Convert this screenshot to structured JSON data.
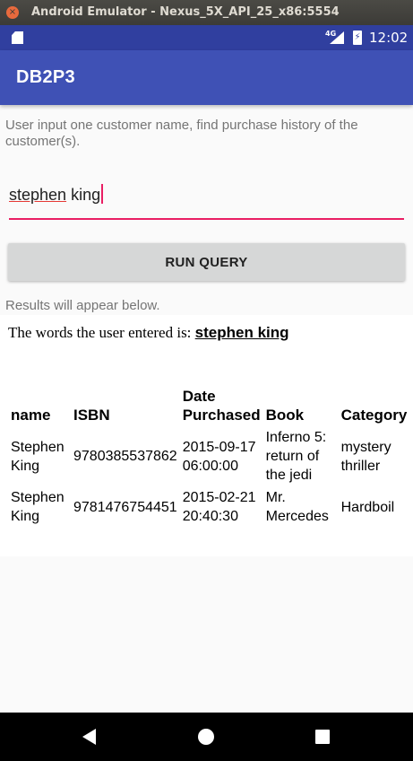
{
  "window": {
    "title": "Android Emulator - Nexus_5X_API_25_x86:5554"
  },
  "status_bar": {
    "network": "4G",
    "time": "12:02"
  },
  "app": {
    "title": "DB2P3"
  },
  "content": {
    "instructions": "User input one customer name, find purchase history of the customer(s).",
    "input_value_part1": "stephen",
    "input_value_part2": " king",
    "run_button": "RUN QUERY",
    "results_hint": "Results will appear below."
  },
  "results": {
    "entered_prefix": "The words the user entered is: ",
    "entered_value": "stephen king",
    "columns": [
      "name",
      "ISBN",
      "Date Purchased",
      "Book",
      "Category"
    ],
    "rows": [
      {
        "name": "Stephen King",
        "isbn": "9780385537862",
        "date": "2015-09-17 06:00:00",
        "book": "Inferno 5: return of the jedi",
        "category": "mystery thriller"
      },
      {
        "name": "Stephen King",
        "isbn": "9781476754451",
        "date": "2015-02-21 20:40:30",
        "book": "Mr. Mercedes",
        "category": "Hardboil"
      }
    ]
  },
  "icons": [
    "close-icon",
    "minimize-icon",
    "maximize-icon",
    "sd-card-icon",
    "signal-icon",
    "battery-icon",
    "back-icon",
    "home-icon",
    "recents-icon"
  ]
}
